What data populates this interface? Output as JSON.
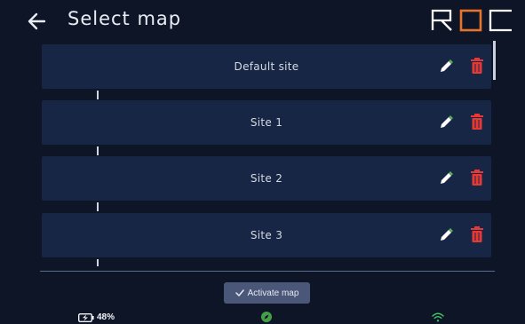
{
  "header": {
    "title": "Select map",
    "back_icon": "arrow-left-icon",
    "logo_text": "ROC"
  },
  "maps": [
    {
      "label": "Default site"
    },
    {
      "label": "Site 1"
    },
    {
      "label": "Site 2"
    },
    {
      "label": "Site 3"
    }
  ],
  "icons": {
    "edit": "pencil-icon",
    "delete": "trash-icon"
  },
  "actions": {
    "activate_label": "Activate map",
    "activate_icon": "check-icon"
  },
  "status": {
    "battery_level": "48%",
    "battery_icon": "battery-charging-icon",
    "compass_icon": "compass-icon",
    "wifi_icon": "wifi-icon"
  },
  "colors": {
    "background": "#0d1526",
    "card": "#172644",
    "logo_accent": "#e8732b",
    "edit_icon": "#ffffff",
    "edit_tip": "#4caf50",
    "delete_icon": "#e53935",
    "activate_button": "#4a5779",
    "compass": "#43a047",
    "wifi": "#43c463"
  }
}
